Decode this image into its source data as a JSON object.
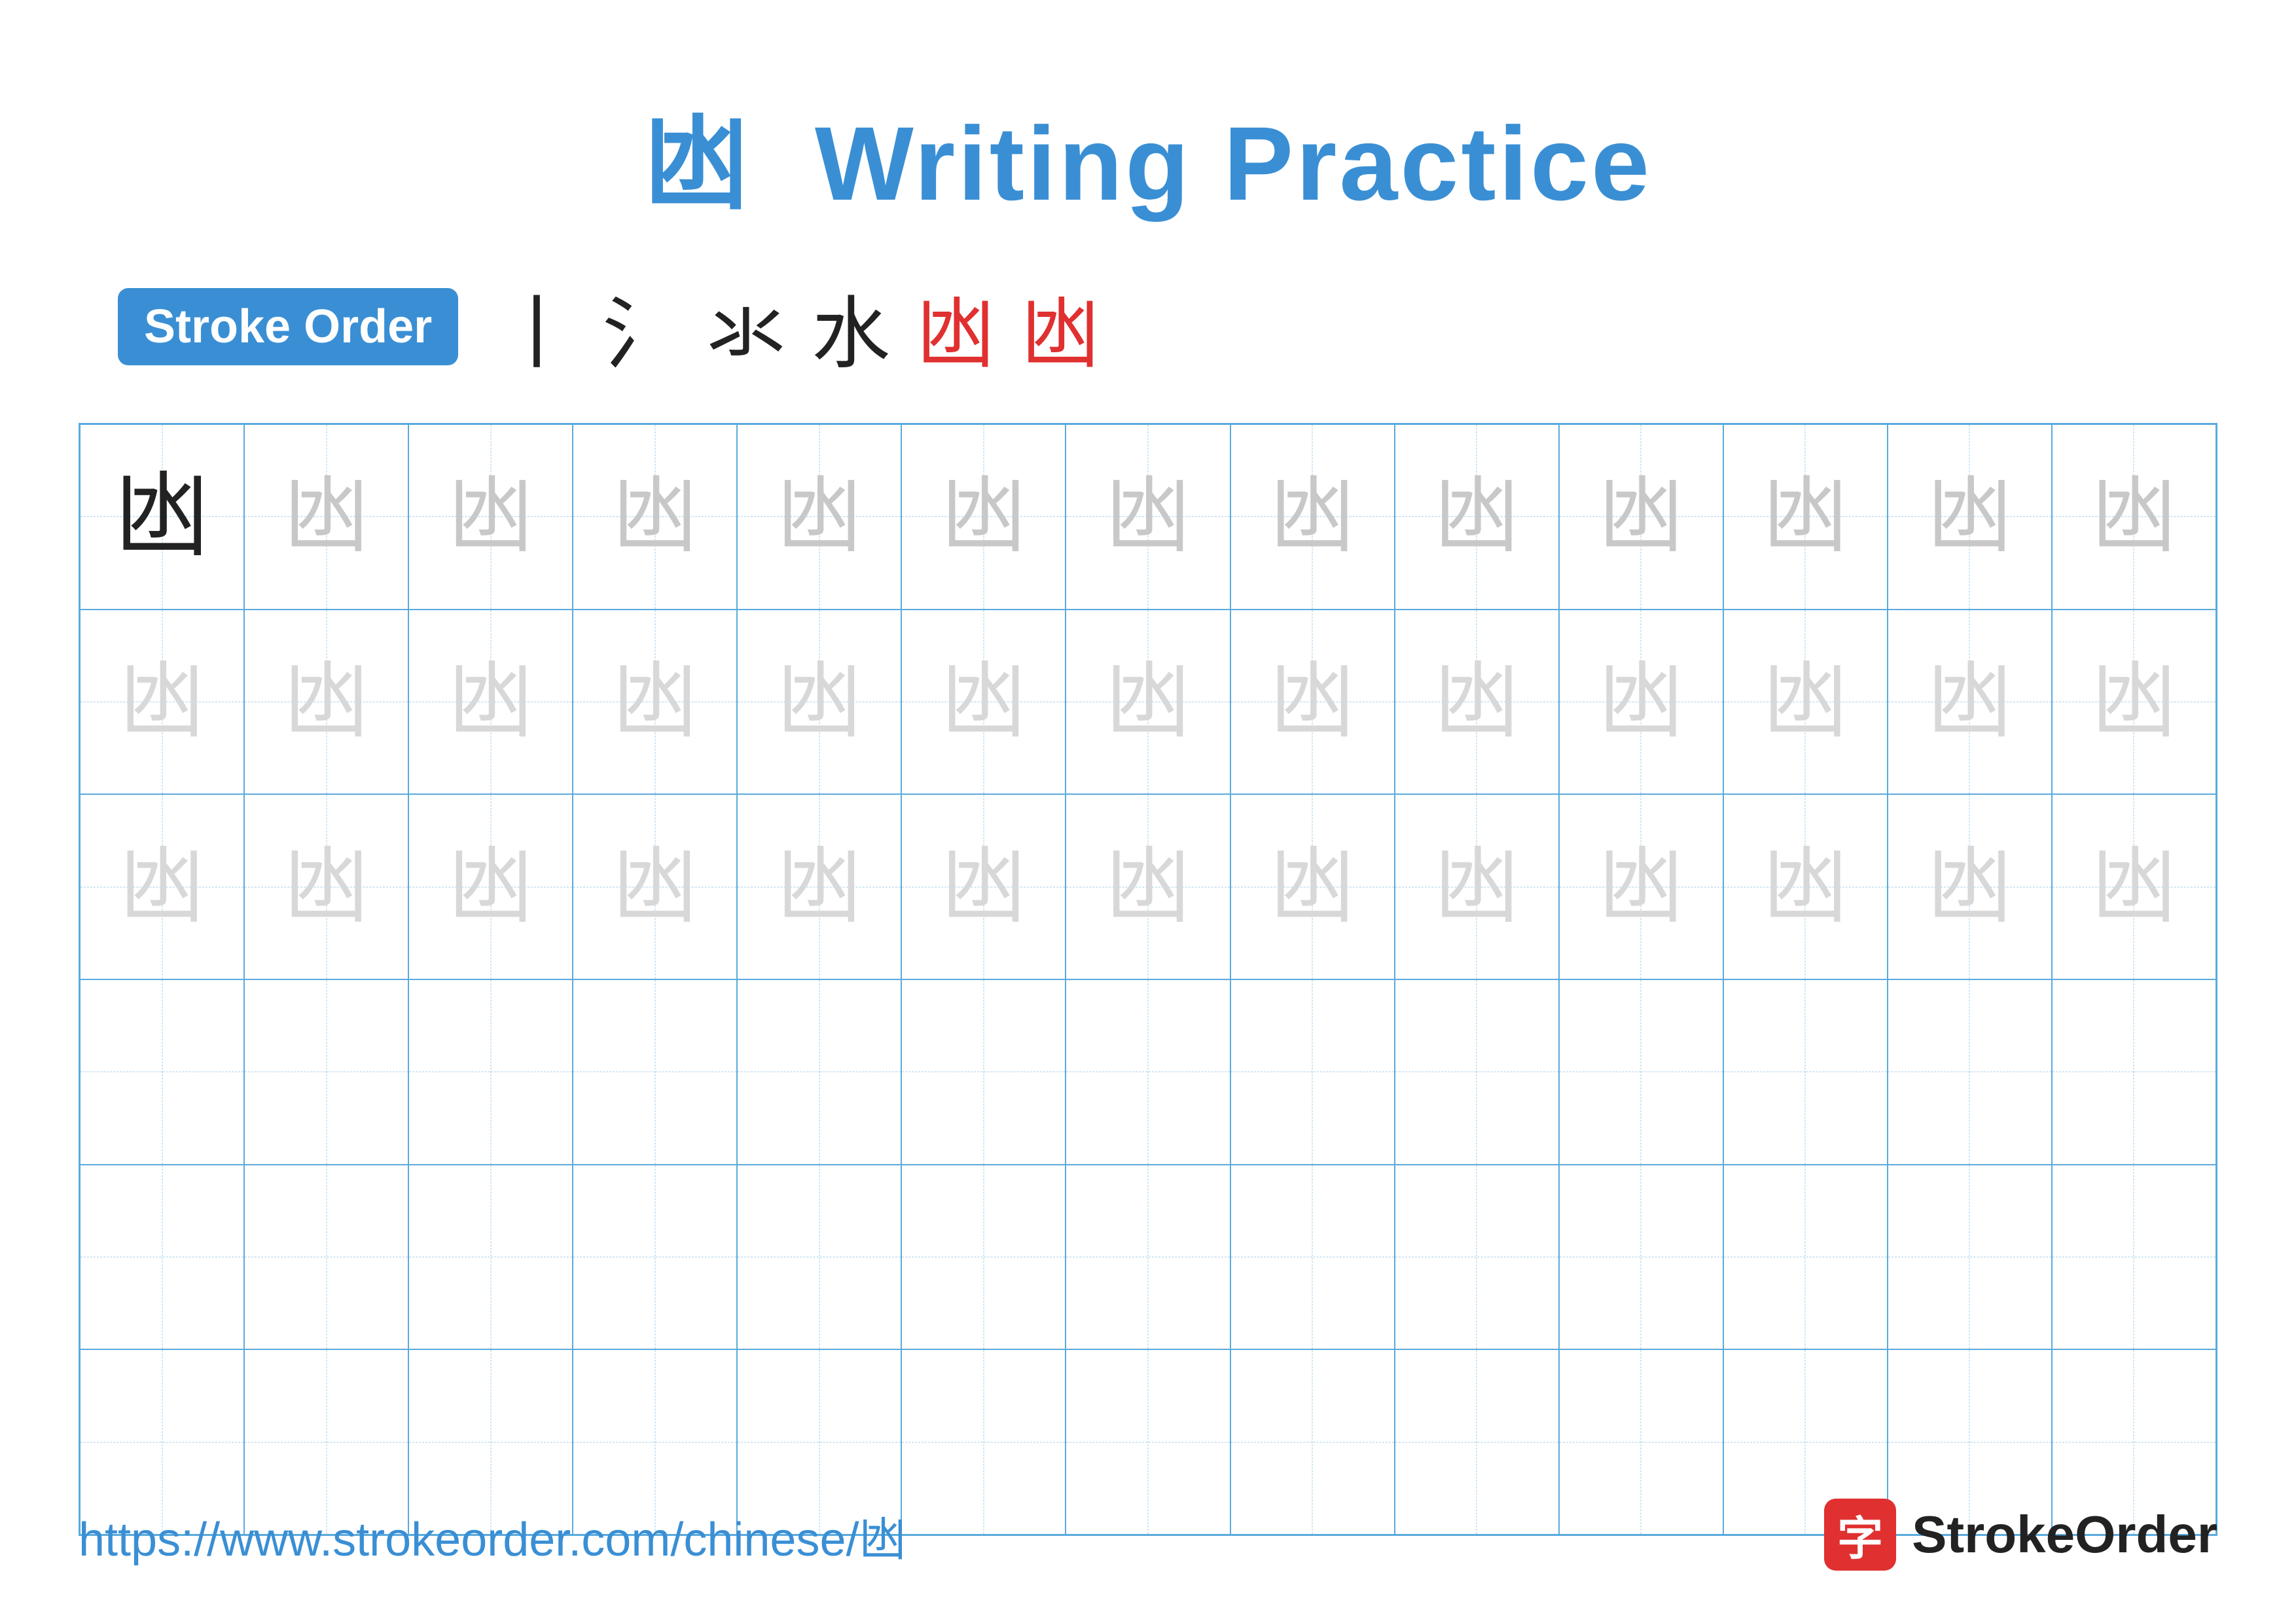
{
  "title": {
    "character": "凼",
    "text": "Writing Practice"
  },
  "stroke_order": {
    "badge_label": "Stroke Order",
    "strokes": [
      {
        "char": "丨",
        "color": "black"
      },
      {
        "char": "氵",
        "color": "black"
      },
      {
        "char": "氺",
        "color": "black"
      },
      {
        "char": "水",
        "color": "black"
      },
      {
        "char": "凼",
        "color": "red"
      },
      {
        "char": "凼",
        "color": "red"
      }
    ]
  },
  "grid": {
    "rows": 6,
    "cols": 13,
    "character": "凼"
  },
  "footer": {
    "url": "https://www.strokeorder.com/chinese/凼",
    "logo_char": "字",
    "logo_text": "StrokeOrder"
  }
}
